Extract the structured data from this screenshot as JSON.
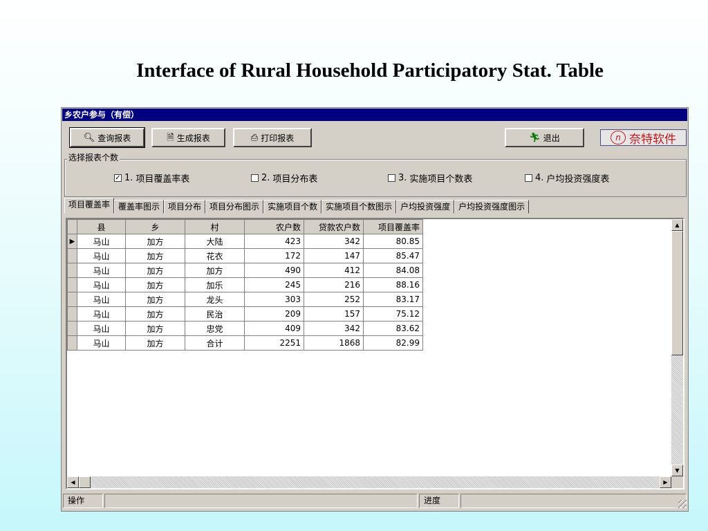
{
  "slide_title": "Interface of Rural Household Participatory Stat. Table",
  "window": {
    "title": "乡农户参与（有偿）"
  },
  "toolbar": {
    "query_label": "查询报表",
    "generate_label": "生成报表",
    "print_label": "打印报表",
    "exit_label": "退出"
  },
  "logo": {
    "mark": "n",
    "text": "奈特软件"
  },
  "report_select": {
    "group_label": "选择报表个数",
    "options": [
      {
        "number": "1.",
        "label": "项目覆盖率表",
        "checked": true
      },
      {
        "number": "2.",
        "label": "项目分布表",
        "checked": false
      },
      {
        "number": "3.",
        "label": "实施项目个数表",
        "checked": false
      },
      {
        "number": "4.",
        "label": "户均投资强度表",
        "checked": false
      }
    ]
  },
  "tabs": [
    "项目覆盖率",
    "覆盖率图示",
    "项目分布",
    "项目分布图示",
    "实施项目个数",
    "实施项目个数图示",
    "户均投资强度",
    "户均投资强度图示"
  ],
  "table": {
    "headers": [
      "县",
      "乡",
      "村",
      "农户数",
      "贷款农户数",
      "项目覆盖率"
    ],
    "rows": [
      [
        "马山",
        "加方",
        "大陆",
        "423",
        "342",
        "80.85"
      ],
      [
        "马山",
        "加方",
        "花衣",
        "172",
        "147",
        "85.47"
      ],
      [
        "马山",
        "加方",
        "加方",
        "490",
        "412",
        "84.08"
      ],
      [
        "马山",
        "加方",
        "加乐",
        "245",
        "216",
        "88.16"
      ],
      [
        "马山",
        "加方",
        "龙头",
        "303",
        "252",
        "83.17"
      ],
      [
        "马山",
        "加方",
        "民治",
        "209",
        "157",
        "75.12"
      ],
      [
        "马山",
        "加方",
        "忠党",
        "409",
        "342",
        "83.62"
      ],
      [
        "马山",
        "加方",
        "合计",
        "2251",
        "1868",
        "82.99"
      ]
    ]
  },
  "status": {
    "operation_label": "操作",
    "progress_label": "进度"
  },
  "icons": {
    "query": "search-icon",
    "generate": "document-icon",
    "print": "printer-icon",
    "exit": "running-man-icon"
  },
  "colors": {
    "titlebar": "#000080",
    "logo": "#c2191c",
    "window_bg": "#d4d0c8"
  }
}
